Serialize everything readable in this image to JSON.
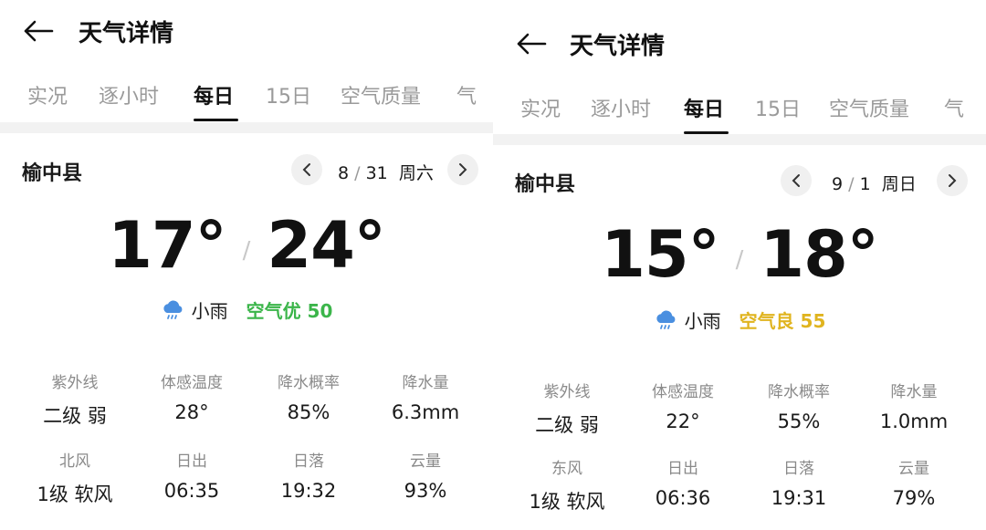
{
  "panels": [
    {
      "header": {
        "title": "天气详情"
      },
      "tabs": [
        "实况",
        "逐小时",
        "每日",
        "15日",
        "空气质量",
        "气"
      ],
      "city": "榆中县",
      "date": {
        "month": "8",
        "day": "31",
        "weekday": "周六"
      },
      "temps": {
        "low": "17°",
        "high": "24°"
      },
      "condition": {
        "icon": "rain-cloud-icon",
        "text": "小雨",
        "aqi_label": "空气优 50",
        "aqi_color": "#3bb54a"
      },
      "details": [
        {
          "label": "紫外线",
          "value": "二级 弱"
        },
        {
          "label": "体感温度",
          "value": "28°"
        },
        {
          "label": "降水概率",
          "value": "85%"
        },
        {
          "label": "降水量",
          "value": "6.3mm"
        },
        {
          "label": "北风",
          "value": "1级 软风"
        },
        {
          "label": "日出",
          "value": "06:35"
        },
        {
          "label": "日落",
          "value": "19:32"
        },
        {
          "label": "云量",
          "value": "93%"
        }
      ]
    },
    {
      "header": {
        "title": "天气详情"
      },
      "tabs": [
        "实况",
        "逐小时",
        "每日",
        "15日",
        "空气质量",
        "气"
      ],
      "city": "榆中县",
      "date": {
        "month": "9",
        "day": "1",
        "weekday": "周日"
      },
      "temps": {
        "low": "15°",
        "high": "18°"
      },
      "condition": {
        "icon": "rain-cloud-icon",
        "text": "小雨",
        "aqi_label": "空气良 55",
        "aqi_color": "#e0b41f"
      },
      "details": [
        {
          "label": "紫外线",
          "value": "二级 弱"
        },
        {
          "label": "体感温度",
          "value": "22°"
        },
        {
          "label": "降水概率",
          "value": "55%"
        },
        {
          "label": "降水量",
          "value": "1.0mm"
        },
        {
          "label": "东风",
          "value": "1级 软风"
        },
        {
          "label": "日出",
          "value": "06:36"
        },
        {
          "label": "日落",
          "value": "19:31"
        },
        {
          "label": "云量",
          "value": "79%"
        }
      ]
    }
  ],
  "active_tab_index": 2,
  "colors": {
    "accent": "#111111",
    "inactive_tab": "#9a9a9a",
    "label_gray": "#8a8a8a",
    "rain_icon": "#4a8fe0"
  }
}
